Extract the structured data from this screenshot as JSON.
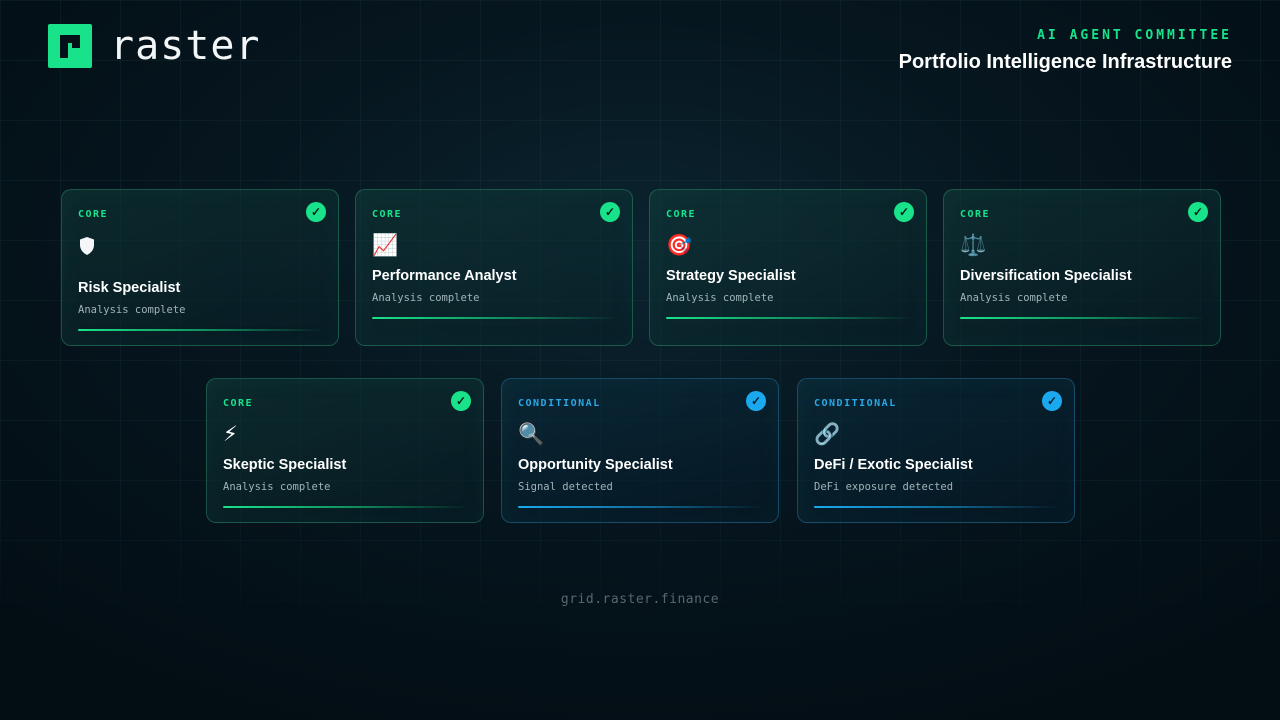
{
  "brand": {
    "name": "raster"
  },
  "header": {
    "eyebrow": "AI AGENT COMMITTEE",
    "title": "Portfolio Intelligence Infrastructure"
  },
  "agents": [
    {
      "tag": "CORE",
      "icon": "shield-icon",
      "glyph": "",
      "name": "Risk Specialist",
      "status": "Analysis complete"
    },
    {
      "tag": "CORE",
      "icon": "chart-increasing-icon",
      "glyph": "📈",
      "name": "Performance Analyst",
      "status": "Analysis complete"
    },
    {
      "tag": "CORE",
      "icon": "target-icon",
      "glyph": "🎯",
      "name": "Strategy Specialist",
      "status": "Analysis complete"
    },
    {
      "tag": "CORE",
      "icon": "scales-icon",
      "glyph": "⚖️",
      "name": "Diversification Specialist",
      "status": "Analysis complete"
    },
    {
      "tag": "CORE",
      "icon": "lightning-icon",
      "glyph": "⚡",
      "name": "Skeptic Specialist",
      "status": "Analysis complete"
    },
    {
      "tag": "CONDITIONAL",
      "icon": "magnifier-icon",
      "glyph": "🔍",
      "name": "Opportunity Specialist",
      "status": "Signal detected"
    },
    {
      "tag": "CONDITIONAL",
      "icon": "link-icon",
      "glyph": "🔗",
      "name": "DeFi / Exotic Specialist",
      "status": "DeFi exposure detected"
    }
  ],
  "check_glyph": "✓",
  "colors": {
    "core": "#19e38a",
    "conditional": "#1aa9ef",
    "background": "#06161f"
  },
  "footer": {
    "url": "grid.raster.finance"
  }
}
